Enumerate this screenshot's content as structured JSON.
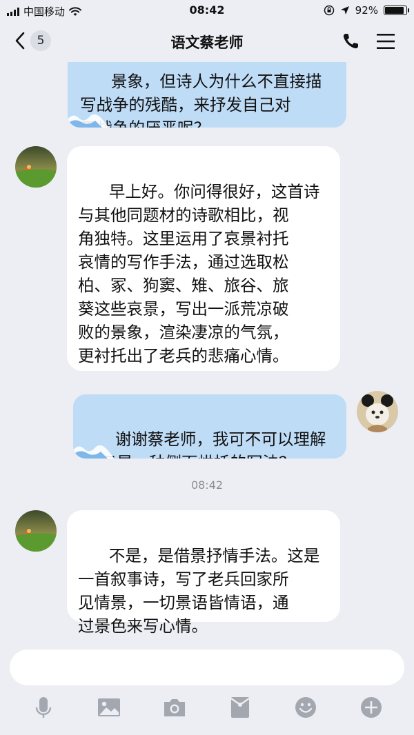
{
  "status_bar": {
    "carrier": "中国移动",
    "time": "08:42",
    "battery_percent": "92%",
    "battery_level": 0.92
  },
  "nav": {
    "back_count": "5",
    "title": "语文蔡老师"
  },
  "messages": [
    {
      "direction": "outgoing",
      "text": "景象，但诗人为什么不直接描\n写战争的残酷，来抒发自己对\n于战争的厌恶呢？"
    },
    {
      "direction": "incoming",
      "text": "早上好。你问得很好，这首诗\n与其他同题材的诗歌相比，视\n角独特。这里运用了哀景衬托\n哀情的写作手法，通过选取松\n柏、冢、狗窦、雉、旅谷、旅\n葵这些哀景，写出一派荒凉破\n败的景象，渲染凄凉的气氛，\n更衬托出了老兵的悲痛心情。"
    },
    {
      "direction": "outgoing",
      "text": "谢谢蔡老师，我可不可以理解\n成只是一种侧面烘托的写法？"
    },
    {
      "direction": "incoming",
      "text": "不是，是借景抒情手法。这是\n一首叙事诗，写了老兵回家所\n见情景，一切景语皆情语，通\n过景色来写心情。"
    }
  ],
  "timestamp": "08:42",
  "input": {
    "value": "",
    "placeholder": ""
  },
  "toolbar": {
    "icons": [
      "microphone-icon",
      "image-icon",
      "camera-icon",
      "red-packet-icon",
      "emoji-icon",
      "plus-icon"
    ]
  },
  "colors": {
    "background": "#eceef3",
    "incoming_bubble": "#ffffff",
    "outgoing_bubble": "#bfdcf7",
    "toolbar_icon": "#a3a7b0"
  }
}
